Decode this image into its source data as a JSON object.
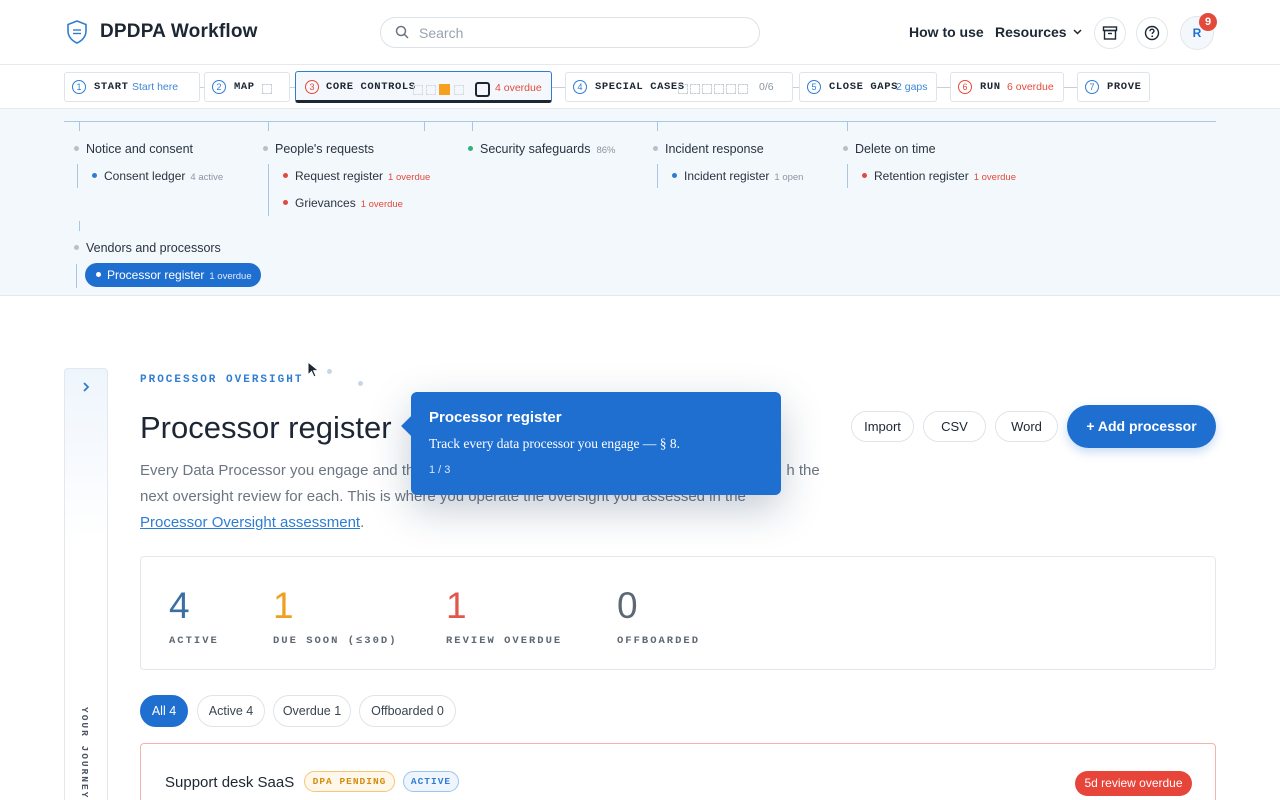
{
  "app": {
    "brand": "DPDPA Workflow",
    "search_placeholder": "Search",
    "nav": {
      "how_to_use": "How to use",
      "resources": "Resources"
    },
    "avatar_initial": "R",
    "notification_count": "9"
  },
  "steps": [
    {
      "num": "1",
      "label": "START",
      "sub": "Start here"
    },
    {
      "num": "2",
      "label": "MAP",
      "sub": ""
    },
    {
      "num": "3",
      "label": "CORE CONTROLS",
      "sub": "4 overdue"
    },
    {
      "num": "4",
      "label": "SPECIAL CASES",
      "sub": "0/6"
    },
    {
      "num": "5",
      "label": "CLOSE GAPS",
      "sub": "2 gaps"
    },
    {
      "num": "6",
      "label": "RUN",
      "sub": "6 overdue"
    },
    {
      "num": "7",
      "label": "PROVE",
      "sub": ""
    }
  ],
  "controls": {
    "notice": {
      "label": "Notice and consent",
      "items": [
        {
          "label": "Consent ledger",
          "meta": "4 active"
        }
      ]
    },
    "requests": {
      "label": "People's requests",
      "items": [
        {
          "label": "Request register",
          "meta": "1 overdue"
        },
        {
          "label": "Grievances",
          "meta": "1 overdue"
        }
      ]
    },
    "security": {
      "label": "Security safeguards",
      "meta": "86%"
    },
    "incident": {
      "label": "Incident response",
      "items": [
        {
          "label": "Incident register",
          "meta": "1 open"
        }
      ]
    },
    "delete": {
      "label": "Delete on time",
      "items": [
        {
          "label": "Retention register",
          "meta": "1 overdue"
        }
      ]
    },
    "vendors": {
      "label": "Vendors and processors",
      "items": [
        {
          "label": "Processor register",
          "meta": "1 overdue"
        }
      ]
    }
  },
  "journey_label": "YOUR JOURNEY",
  "page": {
    "eyebrow": "PROCESSOR OVERSIGHT",
    "title": "Processor register",
    "desc_part1": "Every Data Processor you engage and th",
    "desc_part2": "h the",
    "desc_line2": "next oversight review for each. This is where you operate the oversight you assessed in the",
    "desc_link": "Processor Oversight assessment",
    "desc_end": "."
  },
  "actions": {
    "import": "Import",
    "csv": "CSV",
    "word": "Word",
    "add": "+ Add processor"
  },
  "tooltip": {
    "title": "Processor register",
    "body": "Track every data processor you engage — § 8.",
    "step": "1 / 3"
  },
  "stats": [
    {
      "value": "4",
      "label": "ACTIVE",
      "color": "#3a6ea5"
    },
    {
      "value": "1",
      "label": "DUE SOON (≤30D)",
      "color": "#f0a020"
    },
    {
      "value": "1",
      "label": "REVIEW OVERDUE",
      "color": "#e2574c"
    },
    {
      "value": "0",
      "label": "OFFBOARDED",
      "color": "#5e6874"
    }
  ],
  "filters": [
    {
      "label": "All 4"
    },
    {
      "label": "Active 4"
    },
    {
      "label": "Overdue 1"
    },
    {
      "label": "Offboarded 0"
    }
  ],
  "rows": [
    {
      "name": "Support desk SaaS",
      "tag1": "DPA PENDING",
      "tag2": "ACTIVE",
      "status": "5d review overdue"
    }
  ],
  "colors": {
    "accent": "#1f6fd1",
    "danger": "#e24b3b",
    "warning": "#f0a020"
  }
}
